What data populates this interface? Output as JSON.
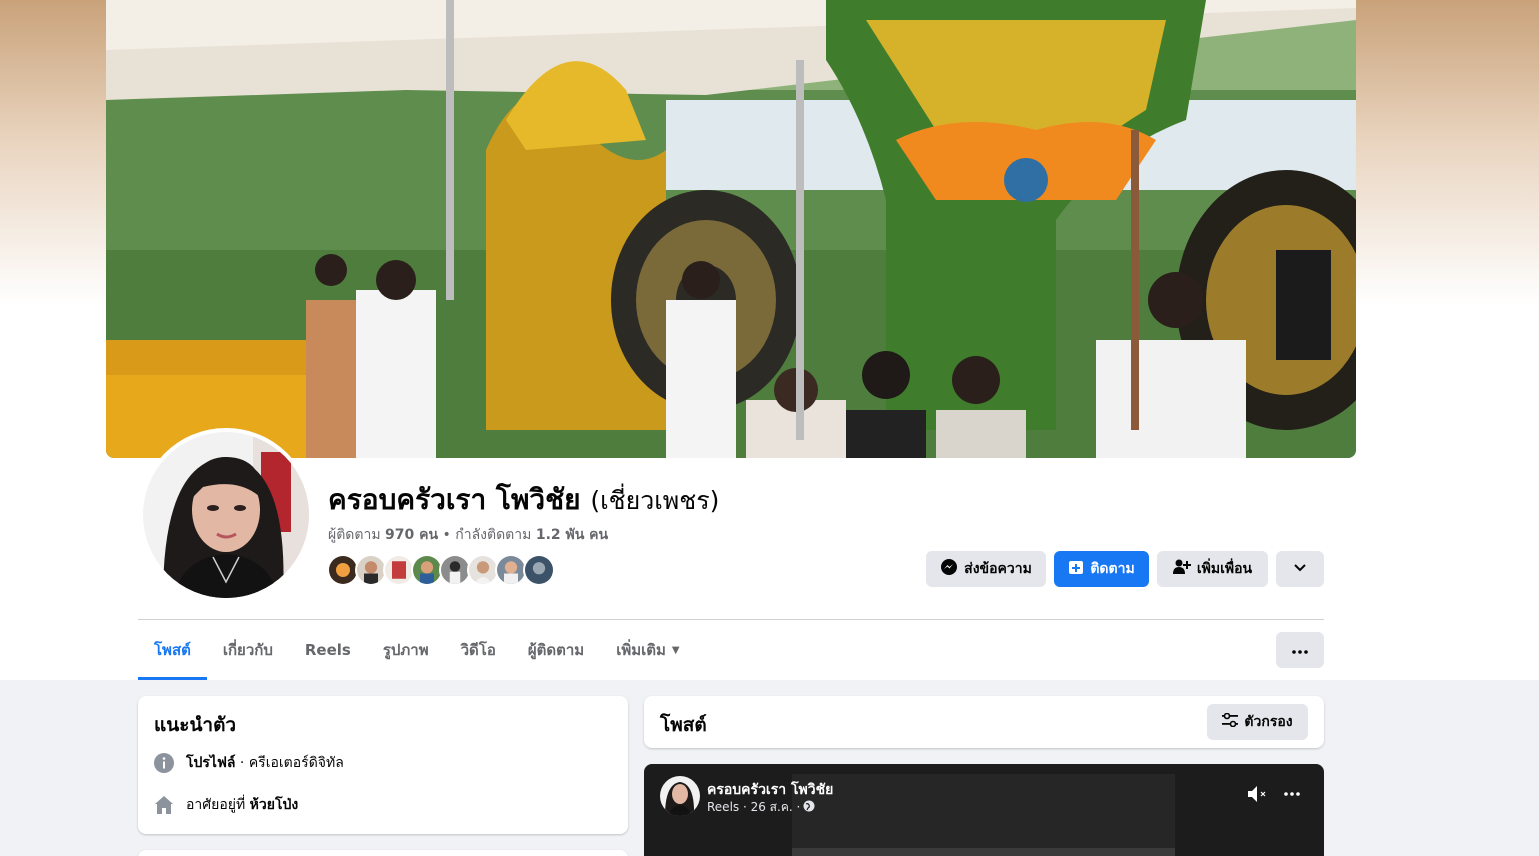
{
  "profile": {
    "name": "ครอบครัวเรา โพวิชัย",
    "alternate_name": "(เชี่ยวเพชร)",
    "followers_label": "ผู้ติดตาม",
    "followers_count": "970 คน",
    "separator": " • ",
    "following_label": "กำลังติดตาม",
    "following_count": "1.2 พัน คน"
  },
  "actions": {
    "message_label": "ส่งข้อความ",
    "follow_label": "ติดตาม",
    "add_friend_label": "เพิ่มเพื่อน"
  },
  "tabs": [
    {
      "label": "โพสต์"
    },
    {
      "label": "เกี่ยวกับ"
    },
    {
      "label": "Reels"
    },
    {
      "label": "รูปภาพ"
    },
    {
      "label": "วิดีโอ"
    },
    {
      "label": "ผู้ติดตาม"
    },
    {
      "label": "เพิ่มเติม"
    }
  ],
  "intro": {
    "title": "แนะนำตัว",
    "profile_label": "โปรไฟล์",
    "profile_category": " · ครีเอเตอร์ดิจิทัล",
    "lives_in_label": "อาศัยอยู่ที่ ",
    "lives_in_value": "ห้วยโป่ง"
  },
  "posts": {
    "title": "โพสต์",
    "filter_label": "ตัวกรอง"
  },
  "reel_post": {
    "author": "ครอบครัวเรา โพวิชัย",
    "meta": "Reels · 26 ส.ค. ·"
  },
  "colors": {
    "accent": "#1877f2",
    "secondary_text": "#65676b",
    "button_gray": "#e4e6eb",
    "page_bg": "#f0f2f5"
  }
}
